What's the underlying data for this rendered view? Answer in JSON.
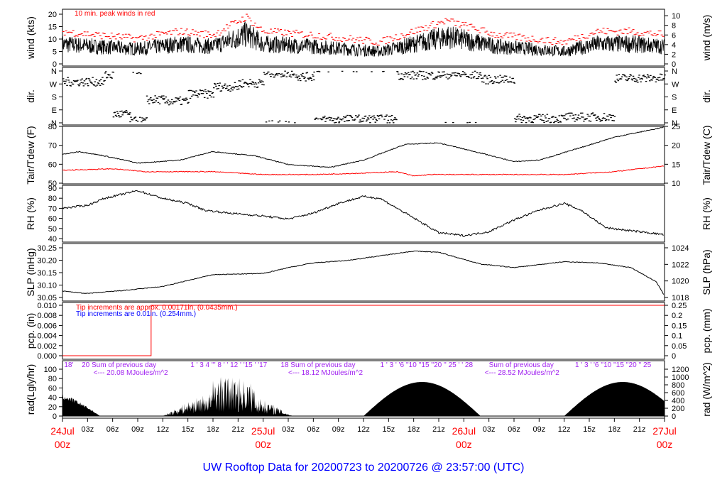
{
  "title": "UW Rooftop Data for 20200723  to  20200726 @ 23:57:00  (UTC)",
  "chart_data": {
    "type": "line",
    "x_unit": "hours since 24Jul 00z",
    "xlim": [
      0,
      72
    ],
    "x_ticks": [
      {
        "h": 0,
        "l1": "24Jul",
        "l2": "00z",
        "big": true
      },
      {
        "h": 3,
        "l1": "03z"
      },
      {
        "h": 6,
        "l1": "06z"
      },
      {
        "h": 9,
        "l1": "09z"
      },
      {
        "h": 12,
        "l1": "12z"
      },
      {
        "h": 15,
        "l1": "15z"
      },
      {
        "h": 18,
        "l1": "18z"
      },
      {
        "h": 21,
        "l1": "21z"
      },
      {
        "h": 24,
        "l1": "25Jul",
        "l2": "00z",
        "big": true
      },
      {
        "h": 27,
        "l1": "03z"
      },
      {
        "h": 30,
        "l1": "06z"
      },
      {
        "h": 33,
        "l1": "09z"
      },
      {
        "h": 36,
        "l1": "12z"
      },
      {
        "h": 39,
        "l1": "15z"
      },
      {
        "h": 42,
        "l1": "18z"
      },
      {
        "h": 45,
        "l1": "21z"
      },
      {
        "h": 48,
        "l1": "26Jul",
        "l2": "00z",
        "big": true
      },
      {
        "h": 51,
        "l1": "03z"
      },
      {
        "h": 54,
        "l1": "06z"
      },
      {
        "h": 57,
        "l1": "09z"
      },
      {
        "h": 60,
        "l1": "12z"
      },
      {
        "h": 63,
        "l1": "15z"
      },
      {
        "h": 66,
        "l1": "18z"
      },
      {
        "h": 69,
        "l1": "21z"
      },
      {
        "h": 72,
        "l1": "27Jul",
        "l2": "00z",
        "big": true
      }
    ],
    "panels": [
      {
        "id": "wind",
        "ylabel": "wind (kts)",
        "ylabel_r": "wind (m/s)",
        "ylim": [
          0,
          20
        ],
        "ticks": [
          "0",
          "5",
          "10",
          "15",
          "20"
        ],
        "ticks_r": [
          "0",
          "2",
          "4",
          "6",
          "8",
          "10"
        ],
        "rlim": [
          0,
          10.29
        ],
        "annotation": "10 min. peak winds in red",
        "mean": [
          [
            0,
            8
          ],
          [
            4,
            7
          ],
          [
            9,
            6
          ],
          [
            14,
            8
          ],
          [
            18,
            7
          ],
          [
            22,
            12
          ],
          [
            24,
            8
          ],
          [
            30,
            7
          ],
          [
            34,
            6
          ],
          [
            38,
            5
          ],
          [
            42,
            8
          ],
          [
            46,
            11
          ],
          [
            49,
            9
          ],
          [
            52,
            7
          ],
          [
            56,
            6
          ],
          [
            60,
            5
          ],
          [
            64,
            8
          ],
          [
            68,
            8
          ],
          [
            72,
            7
          ]
        ]
      },
      {
        "id": "dir",
        "ylabel": "dir.",
        "ylabel_r": "dir.",
        "ylim": [
          0,
          360
        ],
        "ticks": [
          "N",
          "E",
          "S",
          "W",
          "N"
        ],
        "segments": [
          [
            0,
            5,
            285
          ],
          [
            5,
            6,
            330
          ],
          [
            6,
            8,
            60
          ],
          [
            8,
            10,
            10
          ],
          [
            10,
            12,
            160
          ],
          [
            12,
            15,
            150
          ],
          [
            15,
            18,
            200
          ],
          [
            18,
            21,
            250
          ],
          [
            21,
            24,
            275
          ],
          [
            24,
            28,
            345
          ],
          [
            28,
            30,
            320
          ],
          [
            30,
            33,
            20
          ],
          [
            33,
            40,
            25
          ],
          [
            40,
            45,
            330
          ],
          [
            45,
            50,
            335
          ],
          [
            50,
            54,
            300
          ],
          [
            54,
            60,
            30
          ],
          [
            60,
            66,
            40
          ],
          [
            66,
            72,
            310
          ]
        ]
      },
      {
        "id": "temp",
        "ylabel": "Tair/Tdew (F)",
        "ylabel_r": "Tair/Tdew (C)",
        "ylim": [
          45,
          84.5
        ],
        "ticks": [
          "50",
          "60",
          "70",
          "80"
        ],
        "ticks_r": [
          "10",
          "15",
          "20",
          "25"
        ],
        "series": [
          {
            "name": "Tair",
            "color": "#000000",
            "points": [
              [
                0,
                65
              ],
              [
                2,
                67
              ],
              [
                5,
                64
              ],
              [
                9,
                59
              ],
              [
                14,
                61
              ],
              [
                18,
                67
              ],
              [
                23,
                64
              ],
              [
                27,
                58
              ],
              [
                32,
                56
              ],
              [
                36,
                61
              ],
              [
                41,
                72
              ],
              [
                45,
                73
              ],
              [
                50,
                66
              ],
              [
                54,
                60
              ],
              [
                57,
                61
              ],
              [
                61,
                68
              ],
              [
                66,
                77
              ],
              [
                72,
                84
              ]
            ]
          },
          {
            "name": "Tdew",
            "color": "#ff0000",
            "points": [
              [
                0,
                54
              ],
              [
                6,
                55
              ],
              [
                10,
                53
              ],
              [
                18,
                53
              ],
              [
                24,
                51
              ],
              [
                30,
                51
              ],
              [
                36,
                52
              ],
              [
                40,
                53
              ],
              [
                42,
                50
              ],
              [
                44,
                51
              ],
              [
                54,
                51
              ],
              [
                60,
                51
              ],
              [
                66,
                53
              ],
              [
                72,
                57
              ]
            ]
          }
        ]
      },
      {
        "id": "rh",
        "ylabel": "RH (%)",
        "ylabel_r": "RH (%)",
        "ylim": [
          39,
          90.5
        ],
        "ticks": [
          "40",
          "50",
          "60",
          "70",
          "80",
          "90"
        ],
        "series": [
          {
            "name": "RH",
            "color": "#000000",
            "points": [
              [
                0,
                70
              ],
              [
                3,
                73
              ],
              [
                5,
                80
              ],
              [
                9,
                88
              ],
              [
                12,
                80
              ],
              [
                15,
                75
              ],
              [
                17,
                68
              ],
              [
                20,
                65
              ],
              [
                24,
                62
              ],
              [
                27,
                59
              ],
              [
                30,
                65
              ],
              [
                33,
                75
              ],
              [
                36,
                82
              ],
              [
                38,
                80
              ],
              [
                41,
                65
              ],
              [
                45,
                45
              ],
              [
                48,
                42
              ],
              [
                51,
                46
              ],
              [
                54,
                58
              ],
              [
                57,
                68
              ],
              [
                60,
                75
              ],
              [
                62,
                68
              ],
              [
                65,
                50
              ],
              [
                68,
                47
              ],
              [
                72,
                43
              ]
            ]
          }
        ]
      },
      {
        "id": "slp",
        "ylabel": "SLP (inHg)",
        "ylabel_r": "SLP (hPa)",
        "ylim": [
          30.043,
          30.254
        ],
        "ticks": [
          "30.05",
          "30.10",
          "30.15",
          "30.20",
          "30.25"
        ],
        "ticks_r": [
          "1018",
          "1020",
          "1022",
          "1024"
        ],
        "series": [
          {
            "name": "SLP",
            "color": "#000000",
            "points": [
              [
                0,
                30.07
              ],
              [
                3,
                30.06
              ],
              [
                8,
                30.075
              ],
              [
                12,
                30.09
              ],
              [
                18,
                30.14
              ],
              [
                24,
                30.145
              ],
              [
                27,
                30.17
              ],
              [
                30,
                30.19
              ],
              [
                34,
                30.2
              ],
              [
                38,
                30.22
              ],
              [
                42,
                30.24
              ],
              [
                45,
                30.235
              ],
              [
                50,
                30.185
              ],
              [
                54,
                30.17
              ],
              [
                60,
                30.195
              ],
              [
                64,
                30.19
              ],
              [
                68,
                30.17
              ],
              [
                71,
                30.11
              ],
              [
                72,
                30.05
              ]
            ]
          }
        ]
      },
      {
        "id": "pcp",
        "ylabel": "pcp. (in)",
        "ylabel_r": "pcp. (mm)",
        "ylim": [
          0,
          0.0105
        ],
        "ticks": [
          "0.000",
          "0.002",
          "0.004",
          "0.006",
          "0.008",
          "0.010"
        ],
        "ticks_r": [
          "0",
          "0.05",
          "0.1",
          "0.15",
          "0.2",
          "0.25"
        ],
        "note1": "Tip increments are approx. 0.00171in. (0.0435mm.)",
        "note2": "Tip increments are 0.01in. (0.254mm.)",
        "series": [
          {
            "name": "pcp",
            "color": "#ff0000",
            "points": [
              [
                0,
                0
              ],
              [
                10.6,
                0
              ],
              [
                10.6,
                0.0105
              ],
              [
                72,
                0.0105
              ]
            ]
          }
        ]
      },
      {
        "id": "rad",
        "ylabel": "rad(Lgly/hr)",
        "ylabel_r": "rad (W/m^2)",
        "ylim": [
          0,
          110
        ],
        "ticks": [
          "0",
          "20",
          "40",
          "60",
          "80",
          "100"
        ],
        "ticks_r": [
          "0",
          "200",
          "400",
          "600",
          "800",
          "1000",
          "1200"
        ],
        "days": [
          {
            "start": -7,
            "end": 4.5,
            "peak": 80,
            "cloudy": true
          },
          {
            "start": 12,
            "end": 27.5,
            "peak": 85,
            "cloudy": true
          },
          {
            "start": 36,
            "end": 50,
            "peak": 80,
            "cloudy": false
          },
          {
            "start": 60,
            "end": 74,
            "peak": 80,
            "cloudy": false
          }
        ],
        "labels": [
          {
            "h": 0.2,
            "text": "18'"
          },
          {
            "h": 2.3,
            "text": "20 Sum of previous day"
          },
          {
            "h": 3.7,
            "text": "<--- 20.08 MJoules/m^2",
            "row": 2
          },
          {
            "h": 15.3,
            "text": "1 ' 3    4 ''' 8 ' ' 12 ' '15 ' '17"
          },
          {
            "h": 26.1,
            "text": "18 Sum of previous day"
          },
          {
            "h": 27,
            "text": "<--- 18.12 MJoules/m^2",
            "row": 2
          },
          {
            "h": 38,
            "text": "1 ' 3 ' '6 ''10 ''15 ''20 '' 25 ' ' 28"
          },
          {
            "h": 51,
            "text": "Sum of previous day"
          },
          {
            "h": 50.5,
            "text": "<--- 28.52 MJoules/m^2",
            "row": 2
          },
          {
            "h": 61.3,
            "text": "1 ' 3 ' '6 ''10 ''15 ''20 '' 25"
          }
        ]
      }
    ]
  }
}
